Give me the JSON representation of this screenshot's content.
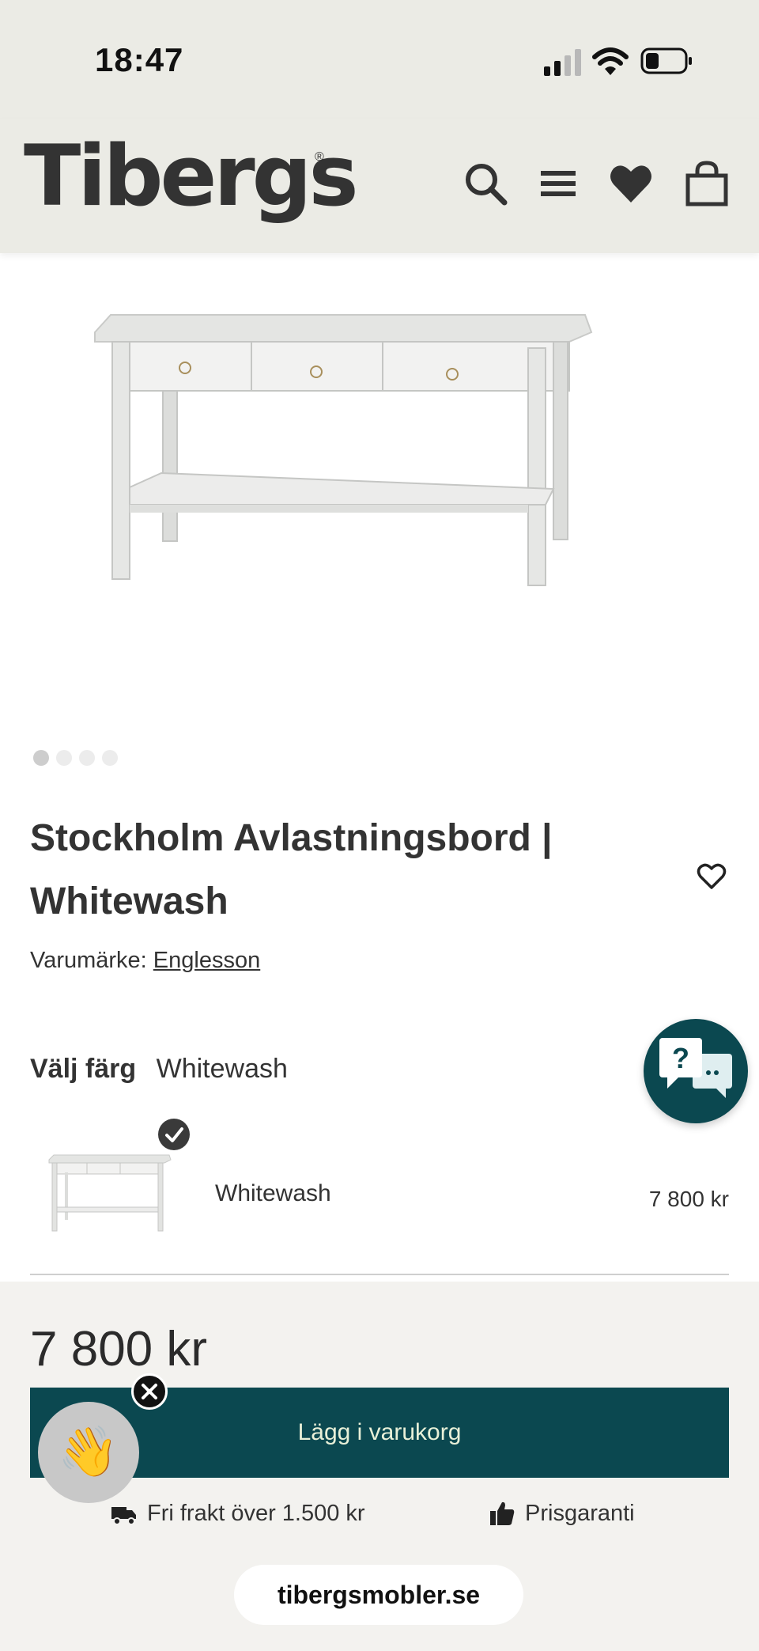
{
  "status_bar": {
    "time": "18:47"
  },
  "header": {
    "logo": "Tibergs",
    "icons": [
      "search-icon",
      "menu-icon",
      "favorites-heart-icon",
      "shopping-bag-icon"
    ]
  },
  "gallery": {
    "image_count": 4,
    "active_index": 0
  },
  "product": {
    "title": "Stockholm Avlastningsbord | Whitewash",
    "brand_label": "Varumärke:",
    "brand_name": "Englesson"
  },
  "color_selector": {
    "label": "Välj färg",
    "selected": "Whitewash",
    "options": [
      {
        "name": "Whitewash",
        "price": "7 800 kr",
        "selected": true
      }
    ]
  },
  "purchase": {
    "price": "7 800 kr",
    "cart_button_label": "Lägg i varukorg",
    "usp": [
      {
        "icon": "truck-icon",
        "text": "Fri frakt över 1.500 kr"
      },
      {
        "icon": "thumbs-up-icon",
        "text": "Prisgaranti"
      }
    ]
  },
  "browser": {
    "url": "tibergsmobler.se"
  },
  "colors": {
    "header_bg": "#ebebe5",
    "accent": "#0b4850",
    "button_text": "#e8f0d8"
  }
}
